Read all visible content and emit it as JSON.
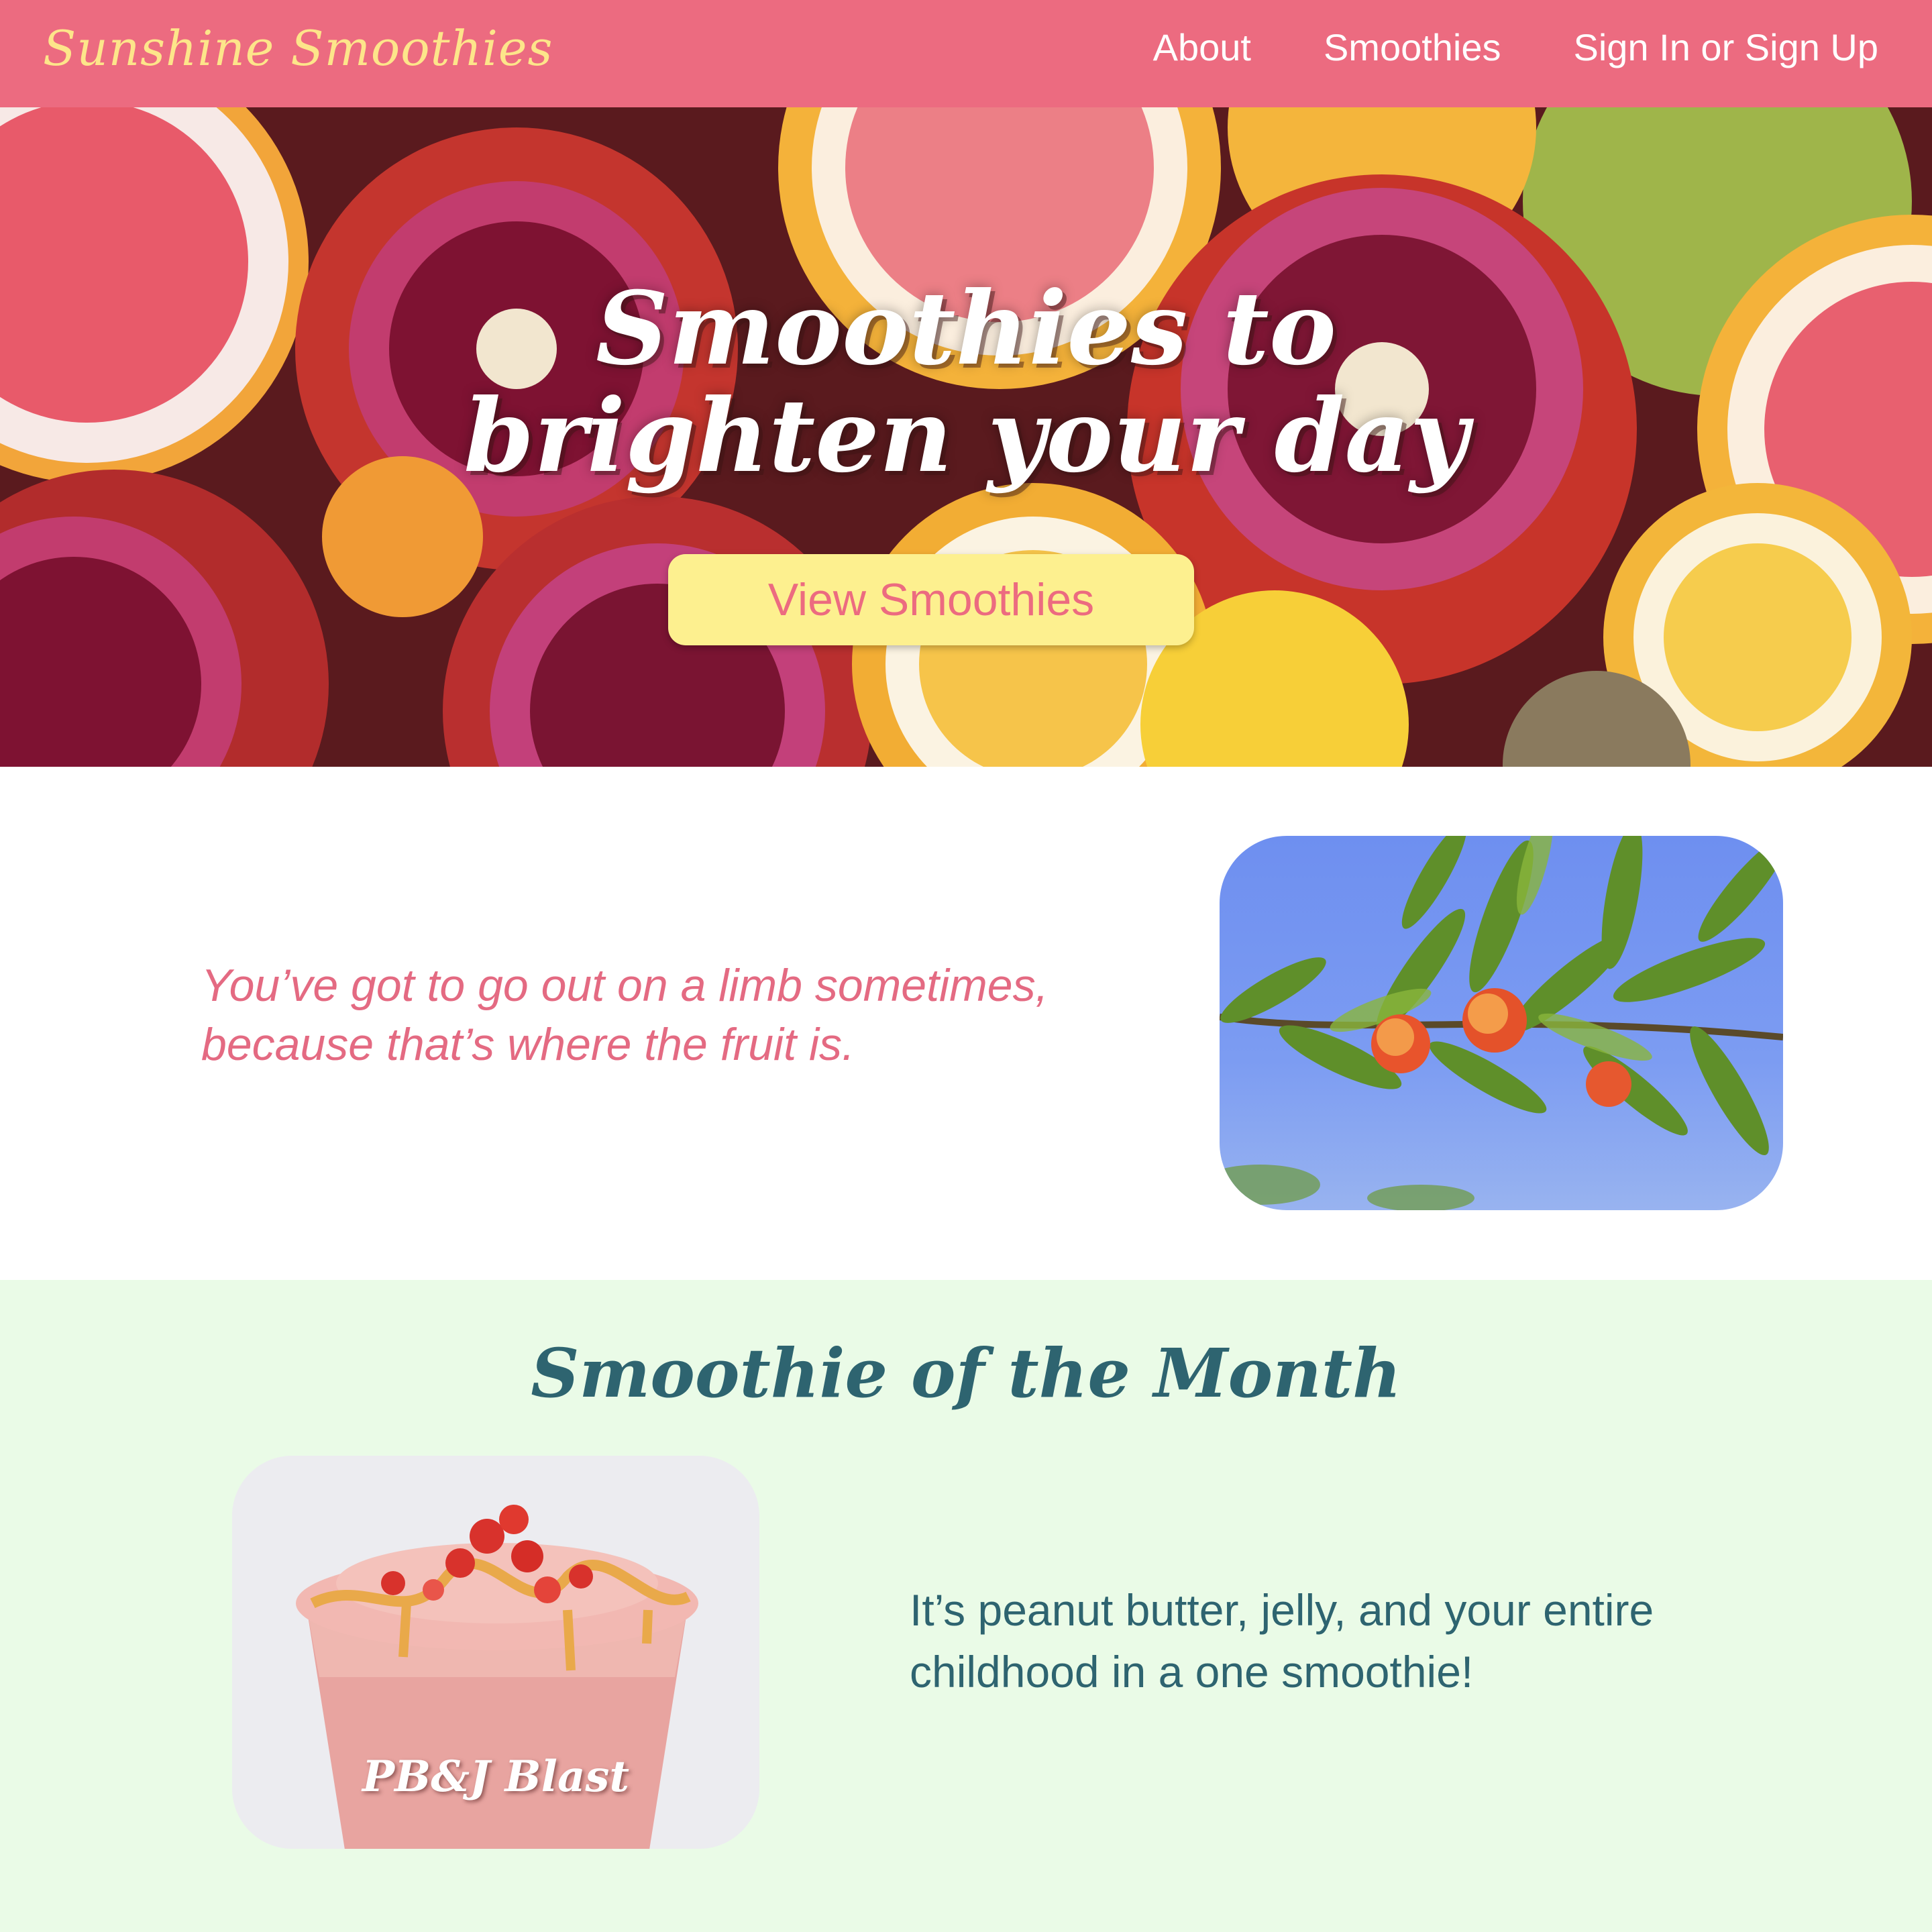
{
  "header": {
    "brand": "Sunshine Smoothies",
    "nav": [
      {
        "label": "About"
      },
      {
        "label": "Smoothies"
      },
      {
        "label": "Sign In or Sign Up"
      }
    ]
  },
  "hero": {
    "title_line1": "Smoothies to",
    "title_line2": "brighten your day",
    "button_label": "View Smoothies",
    "image": "citrus-and-pomegranate-photo"
  },
  "quote": {
    "line1": "You’ve got to go out on a limb sometimes,",
    "line2": "because that’s where the fruit is.",
    "image": "peach-tree-branch-photo"
  },
  "smoothie_of_month": {
    "title": "Smoothie of the Month",
    "card_label": "PB&J Blast",
    "description_line1": "It’s peanut butter, jelly, and your entire",
    "description_line2": "childhood in a one smoothie!",
    "image": "strawberry-smoothie-photo"
  },
  "colors": {
    "header_bg": "#ec6b80",
    "brand_text": "#fde58a",
    "button_bg": "#fdf08f",
    "accent_pink": "#e46a82",
    "section_bg": "#eafbe7",
    "teal_text": "#2e6470"
  }
}
